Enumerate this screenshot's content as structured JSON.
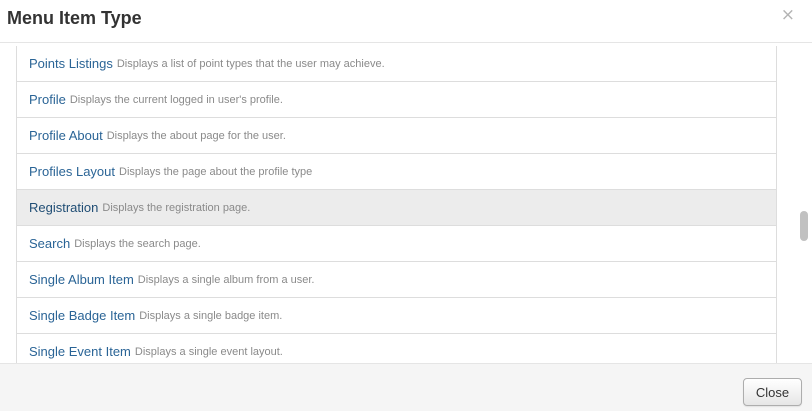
{
  "modal": {
    "title": "Menu Item Type",
    "close_icon": "close-icon",
    "close_glyph": "×"
  },
  "items": [
    {
      "name": "Points Listings",
      "description": "Displays a list of point types that the user may achieve."
    },
    {
      "name": "Profile",
      "description": "Displays the current logged in user's profile."
    },
    {
      "name": "Profile About",
      "description": "Displays the about page for the user."
    },
    {
      "name": "Profiles Layout",
      "description": "Displays the page about the profile type"
    },
    {
      "name": "Registration",
      "description": "Displays the registration page.",
      "highlighted": true
    },
    {
      "name": "Search",
      "description": "Displays the search page."
    },
    {
      "name": "Single Album Item",
      "description": "Displays a single album from a user."
    },
    {
      "name": "Single Badge Item",
      "description": "Displays a single badge item."
    },
    {
      "name": "Single Event Item",
      "description": "Displays a single event layout."
    }
  ],
  "footer": {
    "close_label": "Close"
  }
}
